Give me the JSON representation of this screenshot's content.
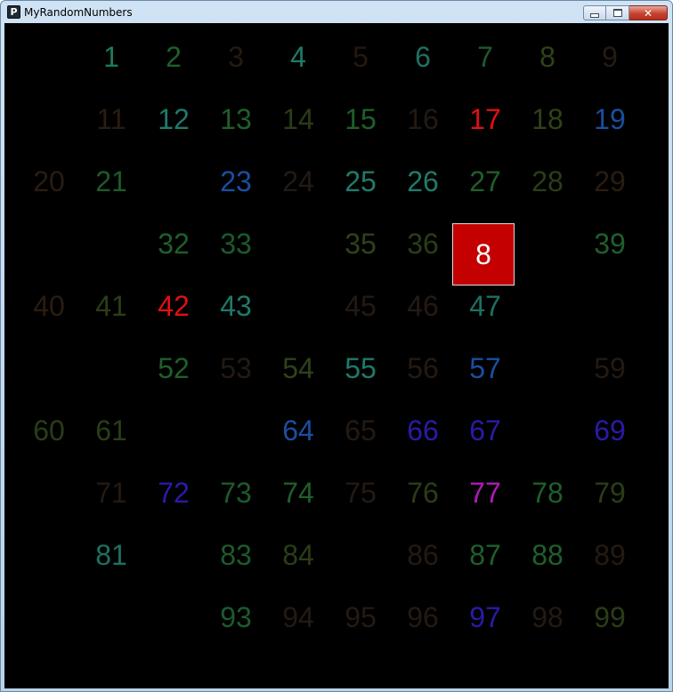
{
  "window": {
    "title": "MyRandomNumbers",
    "icon": "app-icon",
    "icon_glyph": "P"
  },
  "controls": {
    "minimize": "minimize-icon",
    "maximize": "maximize-icon",
    "close": "close-icon",
    "close_glyph": "✕"
  },
  "colors": {
    "background": "#000000",
    "highlight_fill": "#c40000"
  },
  "cells": [
    {
      "n": "1",
      "color": "#1b7a5a",
      "col": 1,
      "row": 0
    },
    {
      "n": "2",
      "color": "#1f5f2a",
      "col": 2,
      "row": 0
    },
    {
      "n": "3",
      "color": "#241a10",
      "col": 3,
      "row": 0
    },
    {
      "n": "4",
      "color": "#1f7a6a",
      "col": 4,
      "row": 0
    },
    {
      "n": "5",
      "color": "#24180f",
      "col": 5,
      "row": 0
    },
    {
      "n": "6",
      "color": "#1f6f62",
      "col": 6,
      "row": 0
    },
    {
      "n": "7",
      "color": "#1d5a2c",
      "col": 7,
      "row": 0
    },
    {
      "n": "8",
      "color": "#2f4219",
      "col": 8,
      "row": 0
    },
    {
      "n": "9",
      "color": "#241c12",
      "col": 9,
      "row": 0
    },
    {
      "n": "11",
      "color": "#2a1c10",
      "col": 1,
      "row": 1
    },
    {
      "n": "12",
      "color": "#1f7a6a",
      "col": 2,
      "row": 1
    },
    {
      "n": "13",
      "color": "#1f5f2a",
      "col": 3,
      "row": 1
    },
    {
      "n": "14",
      "color": "#2a3d17",
      "col": 4,
      "row": 1
    },
    {
      "n": "15",
      "color": "#1f5f2a",
      "col": 5,
      "row": 1
    },
    {
      "n": "16",
      "color": "#241a12",
      "col": 6,
      "row": 1
    },
    {
      "n": "17",
      "color": "#e01010",
      "col": 7,
      "row": 1
    },
    {
      "n": "18",
      "color": "#2f4219",
      "col": 8,
      "row": 1
    },
    {
      "n": "19",
      "color": "#1a4ea0",
      "col": 9,
      "row": 1
    },
    {
      "n": "20",
      "color": "#2a1c10",
      "col": 0,
      "row": 2
    },
    {
      "n": "21",
      "color": "#1d5a2c",
      "col": 1,
      "row": 2
    },
    {
      "n": "23",
      "color": "#1a4ea0",
      "col": 3,
      "row": 2
    },
    {
      "n": "24",
      "color": "#241a12",
      "col": 4,
      "row": 2
    },
    {
      "n": "25",
      "color": "#1f7a6a",
      "col": 5,
      "row": 2
    },
    {
      "n": "26",
      "color": "#1f7a6a",
      "col": 6,
      "row": 2
    },
    {
      "n": "27",
      "color": "#1f5f2a",
      "col": 7,
      "row": 2
    },
    {
      "n": "28",
      "color": "#2a3d17",
      "col": 8,
      "row": 2
    },
    {
      "n": "29",
      "color": "#2a1c10",
      "col": 9,
      "row": 2
    },
    {
      "n": "32",
      "color": "#1f5f2a",
      "col": 2,
      "row": 3
    },
    {
      "n": "33",
      "color": "#1d5a2c",
      "col": 3,
      "row": 3
    },
    {
      "n": "35",
      "color": "#2f4219",
      "col": 5,
      "row": 3
    },
    {
      "n": "36",
      "color": "#2a3d17",
      "col": 6,
      "row": 3
    },
    {
      "n": "8",
      "color": "#ffffff",
      "col": 7,
      "row": 3,
      "highlight": true
    },
    {
      "n": "39",
      "color": "#1f5f2a",
      "col": 9,
      "row": 3
    },
    {
      "n": "40",
      "color": "#2a1c10",
      "col": 0,
      "row": 4
    },
    {
      "n": "41",
      "color": "#2a3d17",
      "col": 1,
      "row": 4
    },
    {
      "n": "42",
      "color": "#e01010",
      "col": 2,
      "row": 4
    },
    {
      "n": "43",
      "color": "#1f7a6a",
      "col": 3,
      "row": 4
    },
    {
      "n": "45",
      "color": "#241a12",
      "col": 5,
      "row": 4
    },
    {
      "n": "46",
      "color": "#241a12",
      "col": 6,
      "row": 4
    },
    {
      "n": "47",
      "color": "#1f6f62",
      "col": 7,
      "row": 4
    },
    {
      "n": "52",
      "color": "#1f5f2a",
      "col": 2,
      "row": 5
    },
    {
      "n": "53",
      "color": "#241a12",
      "col": 3,
      "row": 5
    },
    {
      "n": "54",
      "color": "#2f4219",
      "col": 4,
      "row": 5
    },
    {
      "n": "55",
      "color": "#1f7a6a",
      "col": 5,
      "row": 5
    },
    {
      "n": "56",
      "color": "#241a12",
      "col": 6,
      "row": 5
    },
    {
      "n": "57",
      "color": "#1a4ea0",
      "col": 7,
      "row": 5
    },
    {
      "n": "59",
      "color": "#241a12",
      "col": 9,
      "row": 5
    },
    {
      "n": "60",
      "color": "#2a3d17",
      "col": 0,
      "row": 6
    },
    {
      "n": "61",
      "color": "#2a3d17",
      "col": 1,
      "row": 6
    },
    {
      "n": "64",
      "color": "#1a4ea0",
      "col": 4,
      "row": 6
    },
    {
      "n": "65",
      "color": "#241a12",
      "col": 5,
      "row": 6
    },
    {
      "n": "66",
      "color": "#2a1aa8",
      "col": 6,
      "row": 6
    },
    {
      "n": "67",
      "color": "#2a1aa8",
      "col": 7,
      "row": 6
    },
    {
      "n": "69",
      "color": "#2a1aa8",
      "col": 9,
      "row": 6
    },
    {
      "n": "71",
      "color": "#241a12",
      "col": 1,
      "row": 7
    },
    {
      "n": "72",
      "color": "#2a1aa8",
      "col": 2,
      "row": 7
    },
    {
      "n": "73",
      "color": "#1d5a2c",
      "col": 3,
      "row": 7
    },
    {
      "n": "74",
      "color": "#1f5f2a",
      "col": 4,
      "row": 7
    },
    {
      "n": "75",
      "color": "#241a12",
      "col": 5,
      "row": 7
    },
    {
      "n": "76",
      "color": "#2a3d17",
      "col": 6,
      "row": 7
    },
    {
      "n": "77",
      "color": "#b01ab8",
      "col": 7,
      "row": 7
    },
    {
      "n": "78",
      "color": "#1f5f2a",
      "col": 8,
      "row": 7
    },
    {
      "n": "79",
      "color": "#2a3d17",
      "col": 9,
      "row": 7
    },
    {
      "n": "81",
      "color": "#1f6f62",
      "col": 1,
      "row": 8
    },
    {
      "n": "83",
      "color": "#1d5a2c",
      "col": 3,
      "row": 8
    },
    {
      "n": "84",
      "color": "#2a3d17",
      "col": 4,
      "row": 8
    },
    {
      "n": "86",
      "color": "#241a12",
      "col": 6,
      "row": 8
    },
    {
      "n": "87",
      "color": "#1f5f2a",
      "col": 7,
      "row": 8
    },
    {
      "n": "88",
      "color": "#1f5f2a",
      "col": 8,
      "row": 8
    },
    {
      "n": "89",
      "color": "#241a12",
      "col": 9,
      "row": 8
    },
    {
      "n": "93",
      "color": "#1d5a2c",
      "col": 3,
      "row": 9
    },
    {
      "n": "94",
      "color": "#241a12",
      "col": 4,
      "row": 9
    },
    {
      "n": "95",
      "color": "#241a12",
      "col": 5,
      "row": 9
    },
    {
      "n": "96",
      "color": "#241a12",
      "col": 6,
      "row": 9
    },
    {
      "n": "97",
      "color": "#2a1aa8",
      "col": 7,
      "row": 9
    },
    {
      "n": "98",
      "color": "#241a12",
      "col": 8,
      "row": 9
    },
    {
      "n": "99",
      "color": "#2a3d17",
      "col": 9,
      "row": 9
    }
  ]
}
